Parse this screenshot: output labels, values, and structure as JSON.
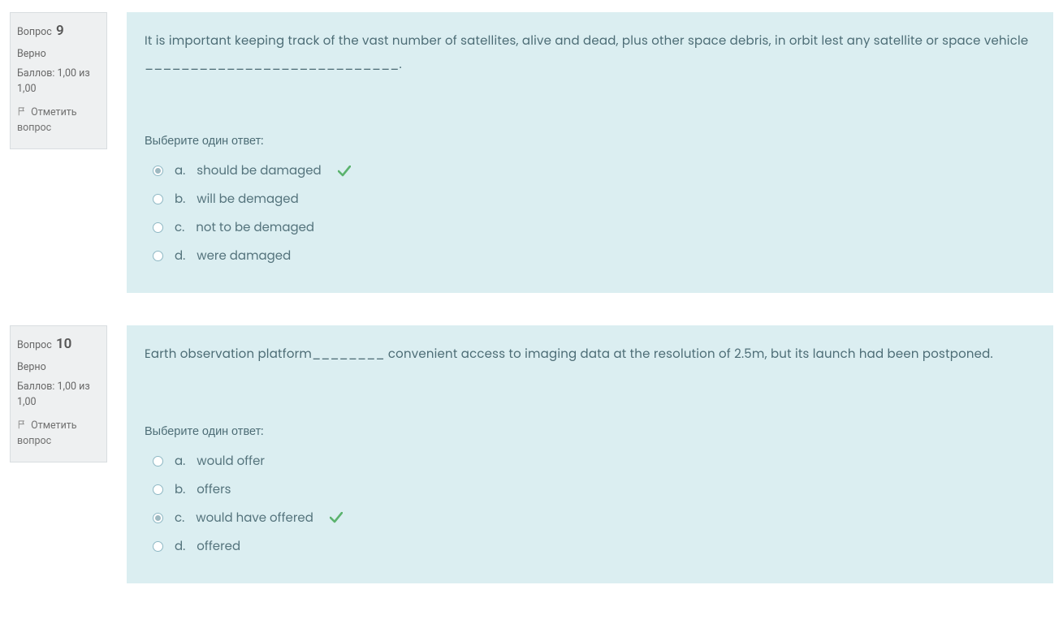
{
  "labels": {
    "question_label": "Вопрос",
    "choose_one": "Выберите один ответ:",
    "flag_question": "Отметить вопрос"
  },
  "questions": [
    {
      "number": "9",
      "state": "Верно",
      "score": "Баллов: 1,00 из 1,00",
      "text": "It is important keeping track of the vast number of satellites, alive and dead, plus other space debris, in orbit lest any satellite or space vehicle ____________________________.",
      "options": [
        {
          "letter": "a.",
          "text": "should be damaged",
          "selected": true,
          "correct": true
        },
        {
          "letter": "b.",
          "text": "will be demaged",
          "selected": false,
          "correct": false
        },
        {
          "letter": "c.",
          "text": "not to be demaged",
          "selected": false,
          "correct": false
        },
        {
          "letter": "d.",
          "text": "were damaged",
          "selected": false,
          "correct": false
        }
      ]
    },
    {
      "number": "10",
      "state": "Верно",
      "score": "Баллов: 1,00 из 1,00",
      "text": "Earth observation platform________ convenient access to imaging data at the resolution of 2.5m, but its launch had been postponed.",
      "options": [
        {
          "letter": "a.",
          "text": "would offer",
          "selected": false,
          "correct": false
        },
        {
          "letter": "b.",
          "text": "offers",
          "selected": false,
          "correct": false
        },
        {
          "letter": "c.",
          "text": "would have offered",
          "selected": true,
          "correct": true
        },
        {
          "letter": "d.",
          "text": "offered",
          "selected": false,
          "correct": false
        }
      ]
    }
  ]
}
